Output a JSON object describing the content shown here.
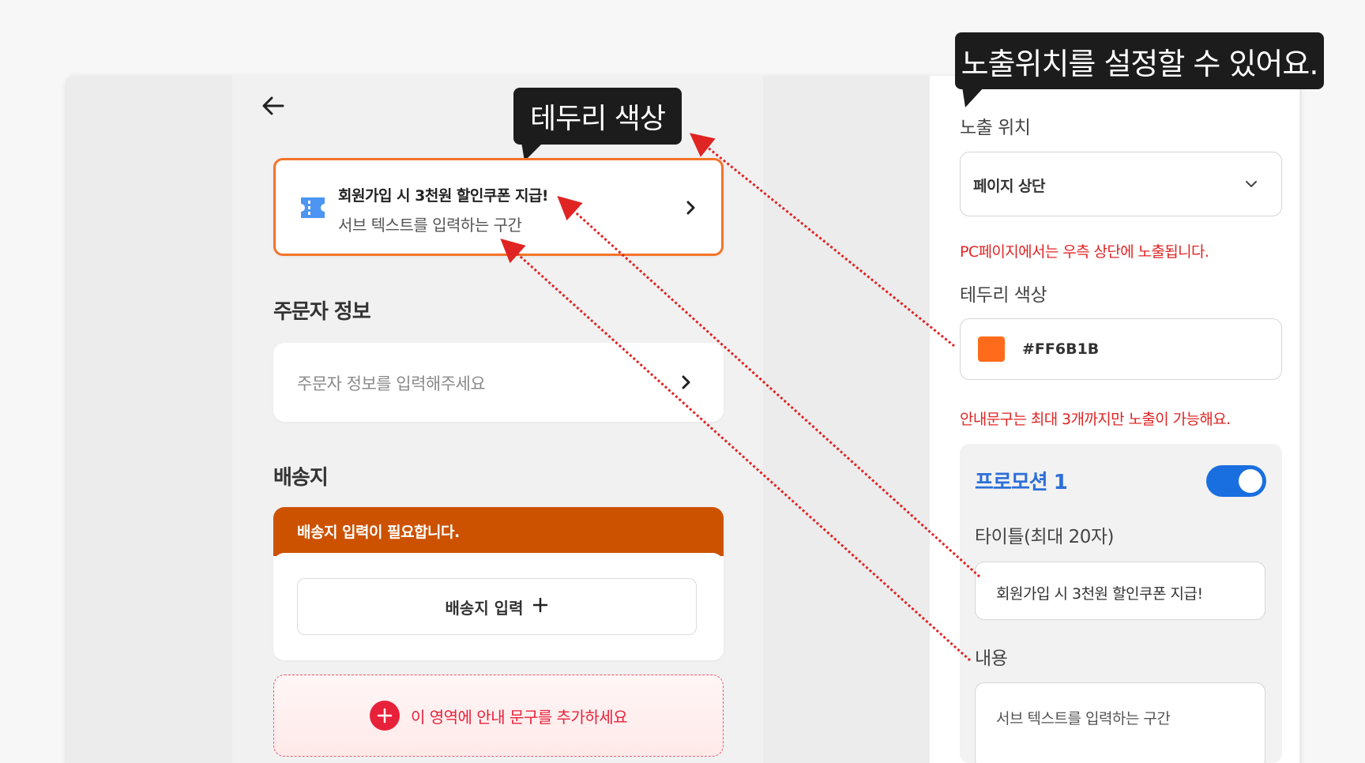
{
  "tooltips": {
    "border_color": "테두리 색상",
    "position": "노출위치를 설정할 수 있어요."
  },
  "banner": {
    "title": "회원가입 시 3천원 할인쿠폰 지급!",
    "subtitle": "서브 텍스트를 입력하는 구간",
    "border_color": "#FF6B1B",
    "icon": "ticket-icon"
  },
  "orderer": {
    "section_title": "주문자 정보",
    "placeholder": "주문자 정보를 입력해주세요"
  },
  "shipping": {
    "section_title": "배송지",
    "warning": "배송지 입력이 필요합니다.",
    "button_label": "배송지 입력",
    "button_icon": "plus-icon"
  },
  "add_notice": {
    "label": "이 영역에 안내 문구를 추가하세요"
  },
  "settings": {
    "position_label": "노출 위치",
    "position_value": "페이지 상단",
    "position_note": "PC페이지에서는 우측 상단에 노출됩니다.",
    "border_color_label": "테두리 색상",
    "border_color_value": "#FF6B1B",
    "limit_note": "안내문구는 최대 3개까지만 노출이 가능해요.",
    "promotion": {
      "title": "프로모션 1",
      "enabled": true,
      "title_label": "타이틀(최대 20자)",
      "title_value": "회원가입  시 3천원 할인쿠폰 지급!",
      "content_label": "내용",
      "content_value": "서브 텍스트를 입력하는 구간"
    }
  },
  "colors": {
    "accent_orange": "#F4742A",
    "warning_bg": "#CC5200",
    "note_red": "#E02424",
    "toggle_blue": "#1A6FE0",
    "promo_blue": "#2D6FD8",
    "annotation_arrow": "#E02424"
  }
}
